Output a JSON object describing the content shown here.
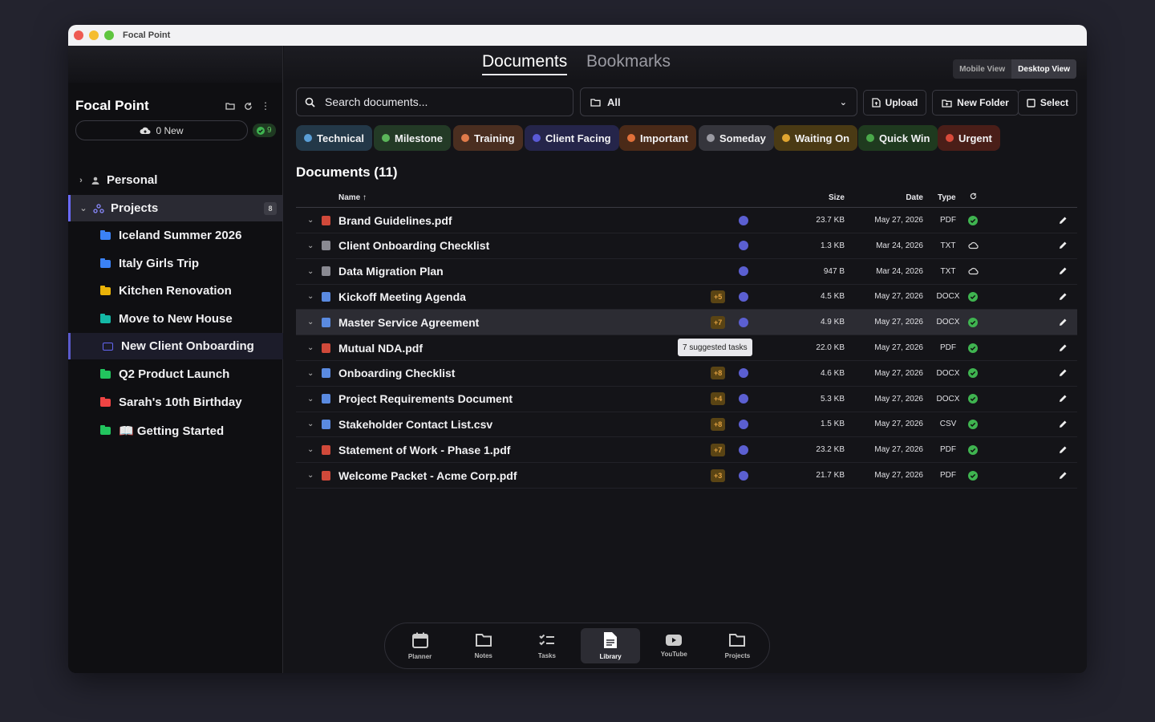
{
  "window": {
    "title": "Focal Point"
  },
  "sidebar": {
    "title": "Focal Point",
    "sync_label": "0 New",
    "sync_badge": "9",
    "personal_label": "Personal",
    "projects_label": "Projects",
    "projects_count": "8",
    "folders": [
      {
        "label": "Iceland Summer 2026",
        "color": "#3b82f6"
      },
      {
        "label": "Italy Girls Trip",
        "color": "#3b82f6"
      },
      {
        "label": "Kitchen Renovation",
        "color": "#eab308"
      },
      {
        "label": "Move to New House",
        "color": "#14b8a6"
      },
      {
        "label": "New Client Onboarding",
        "color": "#6366f1"
      },
      {
        "label": "Q2 Product Launch",
        "color": "#22c55e"
      },
      {
        "label": "Sarah's 10th Birthday",
        "color": "#ef4444"
      },
      {
        "label": "📖 Getting Started",
        "color": "#22c55e"
      }
    ]
  },
  "tabs": {
    "documents": "Documents",
    "bookmarks": "Bookmarks"
  },
  "view_toggle": {
    "mobile": "Mobile View",
    "desktop": "Desktop View"
  },
  "search": {
    "placeholder": "Search documents..."
  },
  "filter": {
    "value": "All"
  },
  "buttons": {
    "upload": "Upload",
    "new_folder": "New Folder",
    "select": "Select"
  },
  "tags": [
    {
      "label": "Technical",
      "color": "#5a9ed6",
      "bg": "#233848"
    },
    {
      "label": "Milestone",
      "color": "#5bb55a",
      "bg": "#233a26"
    },
    {
      "label": "Training",
      "color": "#e07b4a",
      "bg": "#4a2e20"
    },
    {
      "label": "Client Facing",
      "color": "#5a5ad6",
      "bg": "#25254a"
    },
    {
      "label": "Important",
      "color": "#e0703a",
      "bg": "#4a2a18"
    },
    {
      "label": "Someday",
      "color": "#9a9aa2",
      "bg": "#35353c"
    },
    {
      "label": "Waiting On",
      "color": "#e0a530",
      "bg": "#4a3a14"
    },
    {
      "label": "Quick Win",
      "color": "#4aa84a",
      "bg": "#1f3a1f"
    },
    {
      "label": "Urgent",
      "color": "#d84a3a",
      "bg": "#4a1e18"
    }
  ],
  "section_title": "Documents (11)",
  "table": {
    "headers": {
      "name": "Name ↑",
      "size": "Size",
      "date": "Date",
      "type": "Type"
    },
    "rows": [
      {
        "name": "Brand Guidelines.pdf",
        "size": "23.7 KB",
        "date": "May 27, 2026",
        "type": "PDF",
        "sugg": "",
        "status": "check",
        "icon": "pdf"
      },
      {
        "name": "Client Onboarding Checklist",
        "size": "1.3 KB",
        "date": "Mar 24, 2026",
        "type": "TXT",
        "sugg": "",
        "status": "cloud",
        "icon": "txt"
      },
      {
        "name": "Data Migration Plan",
        "size": "947 B",
        "date": "Mar 24, 2026",
        "type": "TXT",
        "sugg": "",
        "status": "cloud",
        "icon": "txt"
      },
      {
        "name": "Kickoff Meeting Agenda",
        "size": "4.5 KB",
        "date": "May 27, 2026",
        "type": "DOCX",
        "sugg": "+5",
        "status": "check",
        "icon": "doc"
      },
      {
        "name": "Master Service Agreement",
        "size": "4.9 KB",
        "date": "May 27, 2026",
        "type": "DOCX",
        "sugg": "+7",
        "status": "check",
        "icon": "doc"
      },
      {
        "name": "Mutual NDA.pdf",
        "size": "22.0 KB",
        "date": "May 27, 2026",
        "type": "PDF",
        "sugg": "",
        "status": "check",
        "icon": "pdf"
      },
      {
        "name": "Onboarding Checklist",
        "size": "4.6 KB",
        "date": "May 27, 2026",
        "type": "DOCX",
        "sugg": "+8",
        "status": "check",
        "icon": "doc"
      },
      {
        "name": "Project Requirements Document",
        "size": "5.3 KB",
        "date": "May 27, 2026",
        "type": "DOCX",
        "sugg": "+4",
        "status": "check",
        "icon": "doc"
      },
      {
        "name": "Stakeholder Contact List.csv",
        "size": "1.5 KB",
        "date": "May 27, 2026",
        "type": "CSV",
        "sugg": "+8",
        "status": "check",
        "icon": "doc"
      },
      {
        "name": "Statement of Work - Phase 1.pdf",
        "size": "23.2 KB",
        "date": "May 27, 2026",
        "type": "PDF",
        "sugg": "+7",
        "status": "check",
        "icon": "pdf"
      },
      {
        "name": "Welcome Packet - Acme Corp.pdf",
        "size": "21.7 KB",
        "date": "May 27, 2026",
        "type": "PDF",
        "sugg": "+3",
        "status": "check",
        "icon": "pdf"
      }
    ]
  },
  "tooltip": "7 suggested tasks",
  "nav": [
    {
      "label": "Planner",
      "icon": "calendar-icon"
    },
    {
      "label": "Notes",
      "icon": "folder-icon"
    },
    {
      "label": "Tasks",
      "icon": "checklist-icon"
    },
    {
      "label": "Library",
      "icon": "document-icon"
    },
    {
      "label": "YouTube",
      "icon": "play-icon"
    },
    {
      "label": "Projects",
      "icon": "folder-icon"
    }
  ]
}
